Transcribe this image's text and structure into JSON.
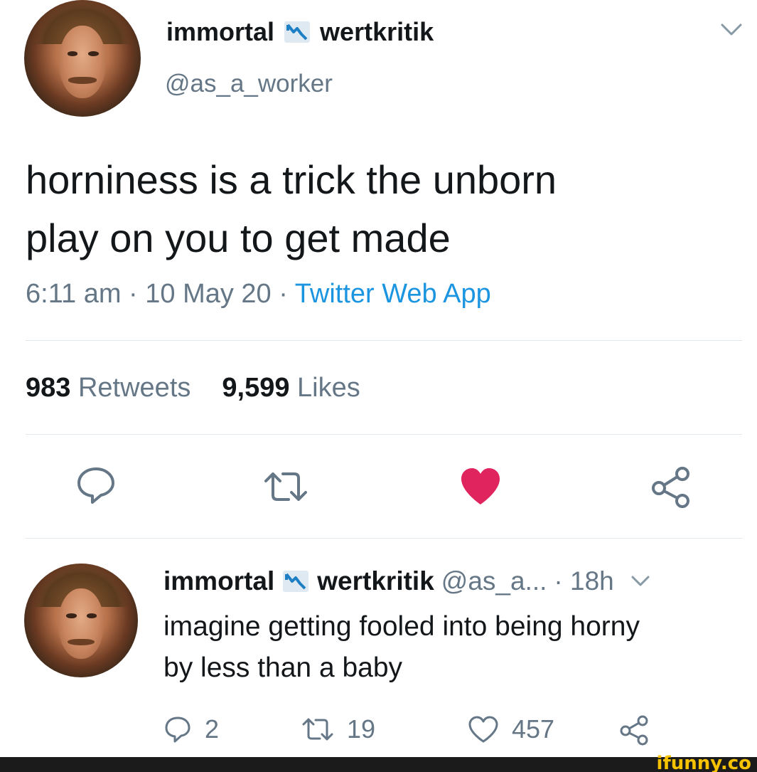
{
  "tweet": {
    "name_part1": "immortal",
    "name_part2": "wertkritik",
    "handle": "@as_a_worker",
    "text_line1": "horniness is a trick the unborn",
    "text_line2": "play on you to get made",
    "time": "6:11 am · 10 May 20 · ",
    "source": "Twitter Web App",
    "retweets_count": "983",
    "retweets_label": "Retweets",
    "likes_count": "9,599",
    "likes_label": "Likes",
    "liked": true
  },
  "reply": {
    "name_part1": "immortal",
    "name_part2": "wertkritik",
    "handle": "@as_a...",
    "time": "· 18h",
    "text_line1": "imagine getting fooled into being horny",
    "text_line2": "by less than a baby",
    "replies": "2",
    "retweets": "19",
    "likes": "457"
  },
  "watermark": "ifunny.co",
  "colors": {
    "accent": "#1b95e0",
    "like_red": "#e0245e",
    "muted": "#657786",
    "text": "#14171a",
    "watermark": "#f7c300"
  },
  "icons": [
    "flag-icon",
    "chevron-down-icon",
    "reply-icon",
    "retweet-icon",
    "heart-icon",
    "share-icon"
  ]
}
